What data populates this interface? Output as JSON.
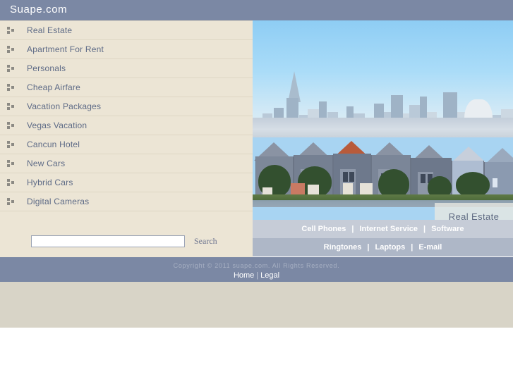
{
  "header": {
    "site_title": "Suape.com",
    "background_color": "#7b88a4"
  },
  "sidebar": {
    "background_color": "#ece5d5",
    "bullet_icon": "three-squares-bullet-icon",
    "items": [
      {
        "label": "Real Estate"
      },
      {
        "label": "Apartment For Rent"
      },
      {
        "label": "Personals"
      },
      {
        "label": "Cheap Airfare"
      },
      {
        "label": "Vacation Packages"
      },
      {
        "label": "Vegas Vacation"
      },
      {
        "label": "Cancun Hotel"
      },
      {
        "label": "New Cars"
      },
      {
        "label": "Hybrid Cars"
      },
      {
        "label": "Digital Cameras"
      }
    ]
  },
  "search": {
    "value": "",
    "placeholder": "",
    "button_label": "Search"
  },
  "hero": {
    "alt": "San Francisco Painted Ladies Victorian houses with downtown skyline",
    "badge_label": "Real Estate"
  },
  "link_bars": [
    {
      "background_color": "#c6ccd7",
      "links": [
        "Cell Phones",
        "Internet Service",
        "Software"
      ],
      "separator": "|"
    },
    {
      "background_color": "#aeb7c7",
      "links": [
        "Ringtones",
        "Laptops",
        "E-mail"
      ],
      "separator": "|"
    }
  ],
  "footer": {
    "copyright": "Copyright © 2011 suape.com. All Rights Reserved.",
    "links": [
      "Home",
      "Legal"
    ],
    "separator": "|",
    "background_color": "#7b88a4"
  }
}
